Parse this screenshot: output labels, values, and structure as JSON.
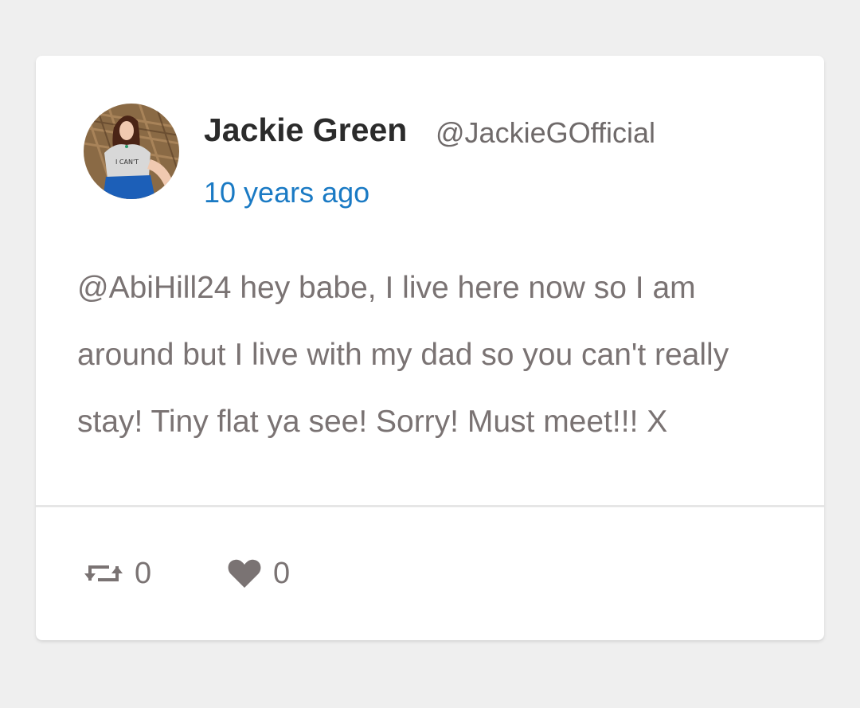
{
  "tweet": {
    "author_name": "Jackie Green",
    "author_handle": "@JackieGOfficial",
    "timestamp": "10 years ago",
    "text": "@AbiHill24 hey babe, I live here now so I am around but I live with my dad so you can't really stay! Tiny flat ya see! Sorry! Must meet!!! X",
    "avatar_shirt_text": "I CAN'T"
  },
  "actions": {
    "retweet_icon": "retweet-icon",
    "retweet_count": "0",
    "like_icon": "heart-icon",
    "like_count": "0"
  },
  "colors": {
    "background": "#efefef",
    "card": "#ffffff",
    "name": "#2b2b2b",
    "handle": "#6f6a6a",
    "timestamp_link": "#1a7ac4",
    "body_text": "#7a7373",
    "icons": "#7a7373"
  }
}
